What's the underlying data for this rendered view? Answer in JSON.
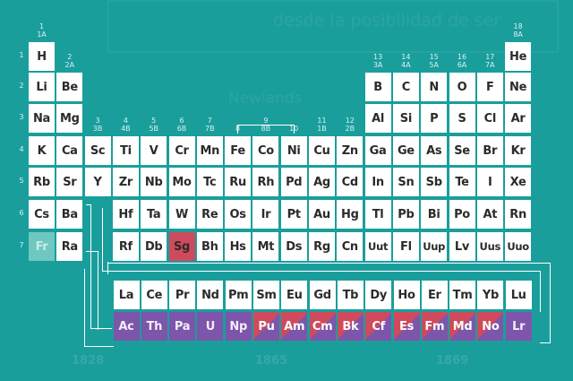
{
  "background": {
    "color": "#1a9e9c",
    "watermark_top": "desde la posibilidad de ser",
    "watermark_left": "Newlands",
    "years": [
      "1828",
      "1865",
      "1869"
    ]
  },
  "colors": {
    "cell": "#ffffff",
    "highlight_red": "#cf4a5c",
    "pale_teal": "#6fc7c1",
    "actinide_purple": "#7d55ab",
    "connector": "#ffffff"
  },
  "period_labels": [
    "1",
    "2",
    "3",
    "4",
    "5",
    "6",
    "7"
  ],
  "group_labels": [
    {
      "num": "1",
      "alt": "1A"
    },
    {
      "num": "2",
      "alt": "2A"
    },
    {
      "num": "3",
      "alt": "3B"
    },
    {
      "num": "4",
      "alt": "4B"
    },
    {
      "num": "5",
      "alt": "5B"
    },
    {
      "num": "6",
      "alt": "6B"
    },
    {
      "num": "7",
      "alt": "7B"
    },
    {
      "num": "8",
      "alt": ""
    },
    {
      "num": "9",
      "alt": "8B"
    },
    {
      "num": "10",
      "alt": ""
    },
    {
      "num": "11",
      "alt": "1B"
    },
    {
      "num": "12",
      "alt": "2B"
    },
    {
      "num": "13",
      "alt": "3A"
    },
    {
      "num": "14",
      "alt": "4A"
    },
    {
      "num": "15",
      "alt": "5A"
    },
    {
      "num": "16",
      "alt": "6A"
    },
    {
      "num": "17",
      "alt": "7A"
    },
    {
      "num": "18",
      "alt": "8A"
    }
  ],
  "elements": [
    {
      "s": "H",
      "g": 1,
      "p": 1
    },
    {
      "s": "He",
      "g": 18,
      "p": 1
    },
    {
      "s": "Li",
      "g": 1,
      "p": 2
    },
    {
      "s": "Be",
      "g": 2,
      "p": 2
    },
    {
      "s": "B",
      "g": 13,
      "p": 2
    },
    {
      "s": "C",
      "g": 14,
      "p": 2
    },
    {
      "s": "N",
      "g": 15,
      "p": 2
    },
    {
      "s": "O",
      "g": 16,
      "p": 2
    },
    {
      "s": "F",
      "g": 17,
      "p": 2
    },
    {
      "s": "Ne",
      "g": 18,
      "p": 2
    },
    {
      "s": "Na",
      "g": 1,
      "p": 3
    },
    {
      "s": "Mg",
      "g": 2,
      "p": 3
    },
    {
      "s": "Al",
      "g": 13,
      "p": 3
    },
    {
      "s": "Si",
      "g": 14,
      "p": 3
    },
    {
      "s": "P",
      "g": 15,
      "p": 3
    },
    {
      "s": "S",
      "g": 16,
      "p": 3
    },
    {
      "s": "Cl",
      "g": 17,
      "p": 3
    },
    {
      "s": "Ar",
      "g": 18,
      "p": 3
    },
    {
      "s": "K",
      "g": 1,
      "p": 4
    },
    {
      "s": "Ca",
      "g": 2,
      "p": 4
    },
    {
      "s": "Sc",
      "g": 3,
      "p": 4
    },
    {
      "s": "Ti",
      "g": 4,
      "p": 4
    },
    {
      "s": "V",
      "g": 5,
      "p": 4
    },
    {
      "s": "Cr",
      "g": 6,
      "p": 4
    },
    {
      "s": "Mn",
      "g": 7,
      "p": 4
    },
    {
      "s": "Fe",
      "g": 8,
      "p": 4
    },
    {
      "s": "Co",
      "g": 9,
      "p": 4
    },
    {
      "s": "Ni",
      "g": 10,
      "p": 4
    },
    {
      "s": "Cu",
      "g": 11,
      "p": 4
    },
    {
      "s": "Zn",
      "g": 12,
      "p": 4
    },
    {
      "s": "Ga",
      "g": 13,
      "p": 4
    },
    {
      "s": "Ge",
      "g": 14,
      "p": 4
    },
    {
      "s": "As",
      "g": 15,
      "p": 4
    },
    {
      "s": "Se",
      "g": 16,
      "p": 4
    },
    {
      "s": "Br",
      "g": 17,
      "p": 4
    },
    {
      "s": "Kr",
      "g": 18,
      "p": 4
    },
    {
      "s": "Rb",
      "g": 1,
      "p": 5
    },
    {
      "s": "Sr",
      "g": 2,
      "p": 5
    },
    {
      "s": "Y",
      "g": 3,
      "p": 5
    },
    {
      "s": "Zr",
      "g": 4,
      "p": 5
    },
    {
      "s": "Nb",
      "g": 5,
      "p": 5
    },
    {
      "s": "Mo",
      "g": 6,
      "p": 5
    },
    {
      "s": "Tc",
      "g": 7,
      "p": 5
    },
    {
      "s": "Ru",
      "g": 8,
      "p": 5
    },
    {
      "s": "Rh",
      "g": 9,
      "p": 5
    },
    {
      "s": "Pd",
      "g": 10,
      "p": 5
    },
    {
      "s": "Ag",
      "g": 11,
      "p": 5
    },
    {
      "s": "Cd",
      "g": 12,
      "p": 5
    },
    {
      "s": "In",
      "g": 13,
      "p": 5
    },
    {
      "s": "Sn",
      "g": 14,
      "p": 5
    },
    {
      "s": "Sb",
      "g": 15,
      "p": 5
    },
    {
      "s": "Te",
      "g": 16,
      "p": 5
    },
    {
      "s": "I",
      "g": 17,
      "p": 5
    },
    {
      "s": "Xe",
      "g": 18,
      "p": 5
    },
    {
      "s": "Cs",
      "g": 1,
      "p": 6
    },
    {
      "s": "Ba",
      "g": 2,
      "p": 6
    },
    {
      "s": "Hf",
      "g": 4,
      "p": 6
    },
    {
      "s": "Ta",
      "g": 5,
      "p": 6
    },
    {
      "s": "W",
      "g": 6,
      "p": 6
    },
    {
      "s": "Re",
      "g": 7,
      "p": 6
    },
    {
      "s": "Os",
      "g": 8,
      "p": 6
    },
    {
      "s": "Ir",
      "g": 9,
      "p": 6
    },
    {
      "s": "Pt",
      "g": 10,
      "p": 6
    },
    {
      "s": "Au",
      "g": 11,
      "p": 6
    },
    {
      "s": "Hg",
      "g": 12,
      "p": 6
    },
    {
      "s": "Tl",
      "g": 13,
      "p": 6
    },
    {
      "s": "Pb",
      "g": 14,
      "p": 6
    },
    {
      "s": "Bi",
      "g": 15,
      "p": 6
    },
    {
      "s": "Po",
      "g": 16,
      "p": 6
    },
    {
      "s": "At",
      "g": 17,
      "p": 6
    },
    {
      "s": "Rn",
      "g": 18,
      "p": 6
    },
    {
      "s": "Fr",
      "g": 1,
      "p": 7,
      "style": "pale"
    },
    {
      "s": "Ra",
      "g": 2,
      "p": 7
    },
    {
      "s": "Rf",
      "g": 4,
      "p": 7
    },
    {
      "s": "Db",
      "g": 5,
      "p": 7
    },
    {
      "s": "Sg",
      "g": 6,
      "p": 7,
      "style": "red"
    },
    {
      "s": "Bh",
      "g": 7,
      "p": 7
    },
    {
      "s": "Hs",
      "g": 8,
      "p": 7
    },
    {
      "s": "Mt",
      "g": 9,
      "p": 7
    },
    {
      "s": "Ds",
      "g": 10,
      "p": 7
    },
    {
      "s": "Rg",
      "g": 11,
      "p": 7
    },
    {
      "s": "Cn",
      "g": 12,
      "p": 7
    },
    {
      "s": "Uut",
      "g": 13,
      "p": 7
    },
    {
      "s": "Fl",
      "g": 14,
      "p": 7
    },
    {
      "s": "Uup",
      "g": 15,
      "p": 7
    },
    {
      "s": "Lv",
      "g": 16,
      "p": 7
    },
    {
      "s": "Uus",
      "g": 17,
      "p": 7
    },
    {
      "s": "Uuo",
      "g": 18,
      "p": 7
    }
  ],
  "lanthanides": [
    "La",
    "Ce",
    "Pr",
    "Nd",
    "Pm",
    "Sm",
    "Eu",
    "Gd",
    "Tb",
    "Dy",
    "Ho",
    "Er",
    "Tm",
    "Yb",
    "Lu"
  ],
  "actinides": [
    {
      "s": "Ac",
      "style": "purple"
    },
    {
      "s": "Th",
      "style": "purple"
    },
    {
      "s": "Pa",
      "style": "purple"
    },
    {
      "s": "U",
      "style": "purple"
    },
    {
      "s": "Np",
      "style": "purple"
    },
    {
      "s": "Pu",
      "style": "diag"
    },
    {
      "s": "Am",
      "style": "diag"
    },
    {
      "s": "Cm",
      "style": "diag"
    },
    {
      "s": "Bk",
      "style": "diag"
    },
    {
      "s": "Cf",
      "style": "diag"
    },
    {
      "s": "Es",
      "style": "diag"
    },
    {
      "s": "Fm",
      "style": "diag"
    },
    {
      "s": "Md",
      "style": "diag"
    },
    {
      "s": "No",
      "style": "diag"
    },
    {
      "s": "Lr",
      "style": "purple"
    }
  ]
}
